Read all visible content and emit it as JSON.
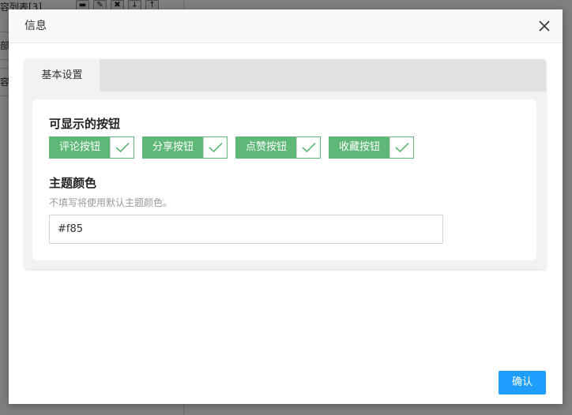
{
  "background": {
    "rows": [
      "容列表[3]",
      "部",
      "容"
    ],
    "tools": [
      "▬",
      "✎",
      "✖",
      "↓",
      "↑"
    ]
  },
  "dialog": {
    "title": "信息",
    "tab": "基本设置",
    "section_buttons": "可显示的按钮",
    "buttons": [
      {
        "label": "评论按钮",
        "checked": true
      },
      {
        "label": "分享按钮",
        "checked": true
      },
      {
        "label": "点赞按钮",
        "checked": true
      },
      {
        "label": "收藏按钮",
        "checked": true
      }
    ],
    "section_color": "主题颜色",
    "color_hint": "不填写将使用默认主题颜色。",
    "color_value": "#f85",
    "confirm_label": "确认"
  },
  "colors": {
    "accent_green": "#5fb878",
    "confirm_blue": "#1e9fff"
  }
}
